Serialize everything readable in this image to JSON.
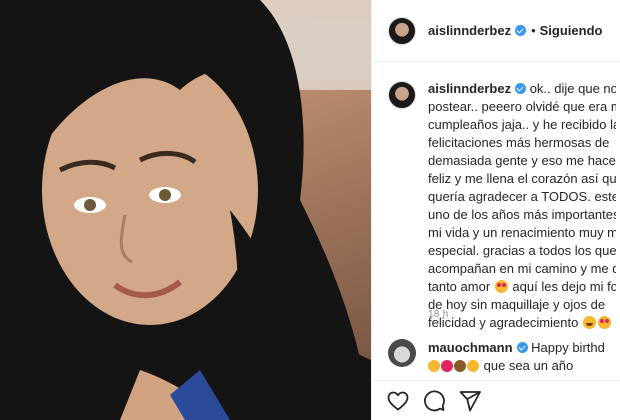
{
  "post": {
    "username": "aislinnderbez",
    "follow_status": "Siguiendo",
    "separator": "•",
    "caption_lines": [
      "ok.. dije que no iba",
      "postear.. peeero olvidé que era mi",
      "cumpleaños jaja.. y he recibido las",
      "felicitaciones más hermosas de",
      "demasiada gente y eso me hace mu",
      "feliz y me llena el corazón así que le",
      "quería agradecer a TODOS. este es",
      "uno de los años más importantes d",
      "mi vida y un renacimiento muy muy",
      "especial. gracias a todos los que me",
      "acompañan en mi camino y me dan",
      "tanto amor",
      "aquí les dejo mi foto",
      "de hoy sin maquillaje y ojos de",
      "felicidad y agradecimiento"
    ],
    "time_ago": "18 h"
  },
  "comment": {
    "username": "mauochmann",
    "line1": "Happy birthd",
    "line2": "que sea un año"
  },
  "icons": {
    "verified": "verified-badge-icon",
    "like": "heart-icon",
    "comment": "comment-icon",
    "share": "share-icon"
  },
  "colors": {
    "verified_blue": "#3897f0",
    "text": "#262626",
    "muted": "#8e8e8e",
    "border": "#efefef"
  }
}
